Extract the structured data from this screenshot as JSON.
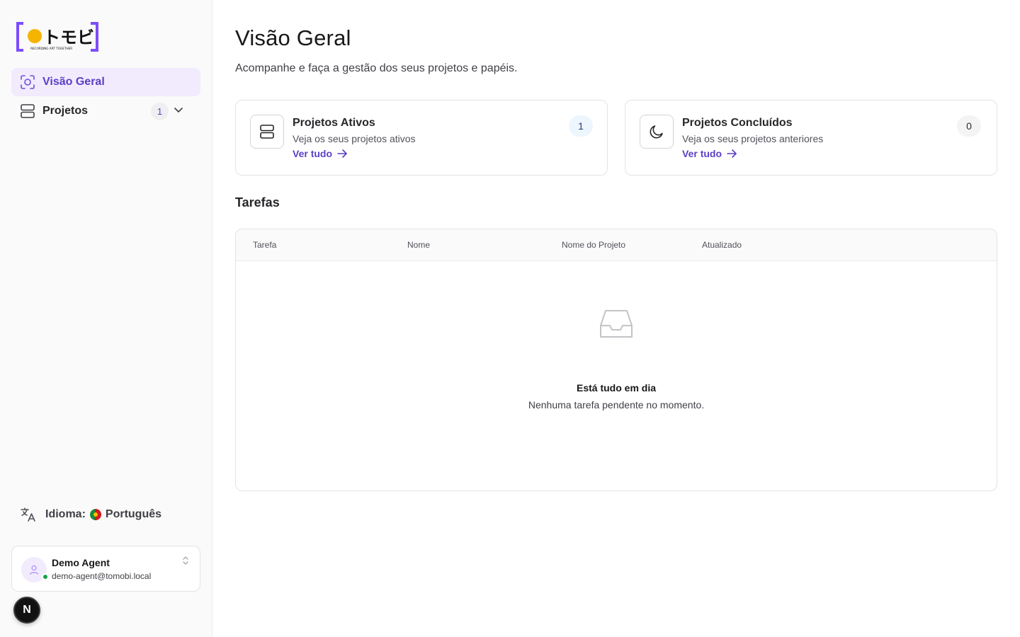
{
  "app": {
    "logo_text": "トモビ",
    "logo_tagline": "RECORDING ART TOGETHER",
    "brand_color": "#5b3fc4",
    "logo_dot_color": "#f5b400"
  },
  "sidebar": {
    "items": [
      {
        "label": "Visão Geral",
        "icon": "focus-scan-icon",
        "active": true
      },
      {
        "label": "Projetos",
        "icon": "server-stack-icon",
        "count": "1",
        "expand_icon": "chevron-down-icon"
      }
    ],
    "language": {
      "label": "Idioma:",
      "value": "Português",
      "icon": "translate-icon",
      "flag": "portugal-flag"
    },
    "user": {
      "name": "Demo Agent",
      "email": "demo-agent@tomobi.local",
      "status": "online"
    },
    "dev_badge": "N"
  },
  "main": {
    "title": "Visão Geral",
    "subtitle": "Acompanhe e faça a gestão dos seus projetos e papéis.",
    "cards": [
      {
        "title": "Projetos Ativos",
        "description": "Veja os seus projetos ativos",
        "link": "Ver tudo",
        "count": "1",
        "icon": "server-stack-icon"
      },
      {
        "title": "Projetos Concluídos",
        "description": "Veja os seus projetos anteriores",
        "link": "Ver tudo",
        "count": "0",
        "icon": "moon-icon"
      }
    ],
    "tasks": {
      "title": "Tarefas",
      "columns": [
        "Tarefa",
        "Nome",
        "Nome do Projeto",
        "Atualizado"
      ],
      "empty_title": "Está tudo em dia",
      "empty_description": "Nenhuma tarefa pendente no momento."
    }
  }
}
